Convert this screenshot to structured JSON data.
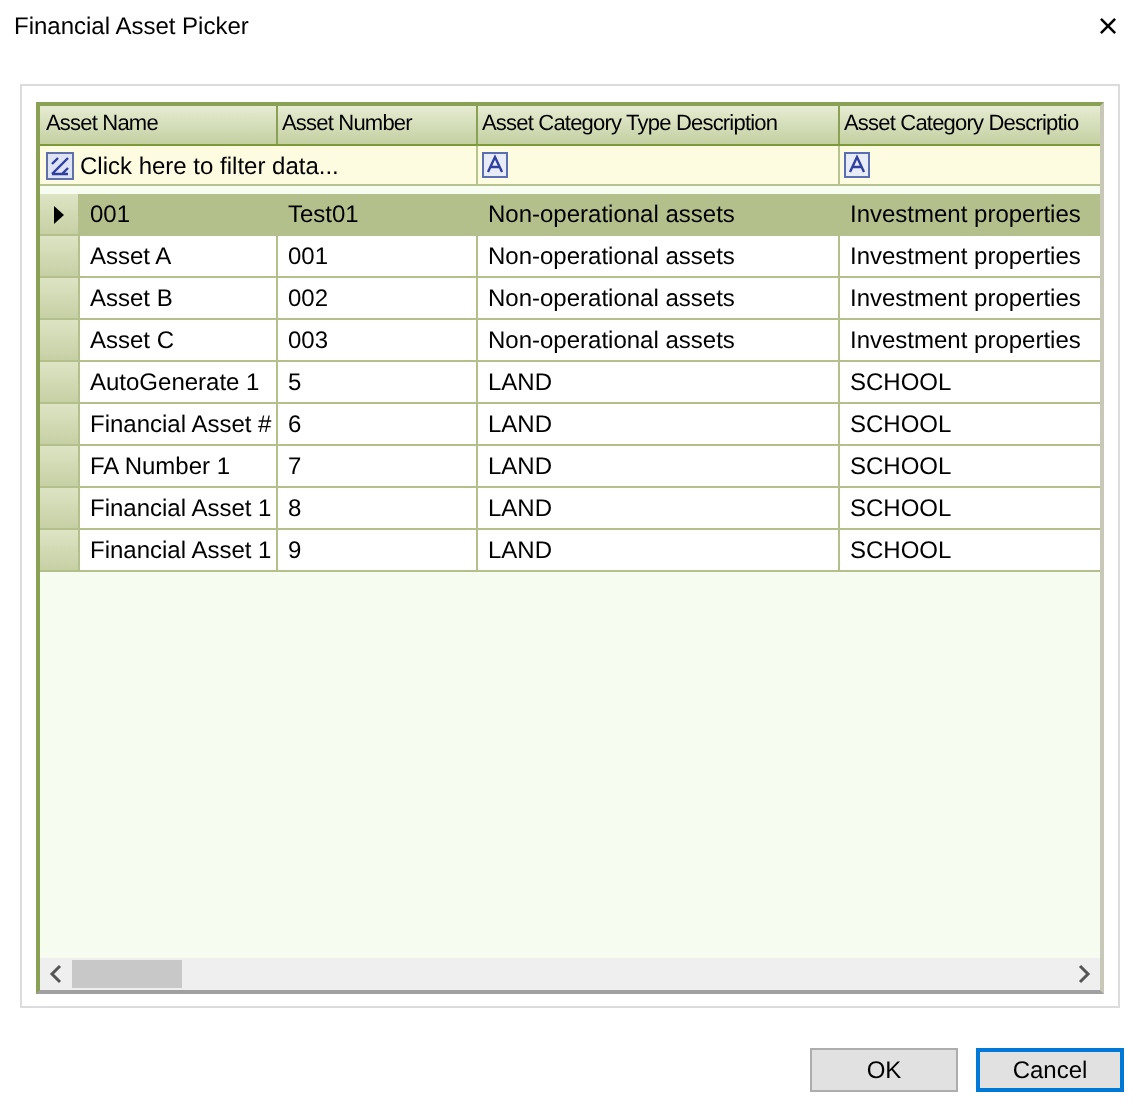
{
  "window": {
    "title": "Financial Asset Picker",
    "close": "×"
  },
  "table": {
    "columns": [
      "Asset Name",
      "Asset Number",
      "Asset Category Type Description",
      "Asset Category Descriptio"
    ],
    "filter_prompt": "Click here to filter data...",
    "rows": [
      {
        "cells": [
          "001",
          "Test01",
          "Non-operational assets",
          "Investment properties"
        ],
        "selected": true
      },
      {
        "cells": [
          "Asset A",
          "001",
          "Non-operational assets",
          "Investment properties"
        ],
        "selected": false
      },
      {
        "cells": [
          "Asset B",
          "002",
          "Non-operational assets",
          "Investment properties"
        ],
        "selected": false
      },
      {
        "cells": [
          "Asset C",
          "003",
          "Non-operational assets",
          "Investment properties"
        ],
        "selected": false
      },
      {
        "cells": [
          "AutoGenerate 1",
          "5",
          "LAND",
          "SCHOOL"
        ],
        "selected": false
      },
      {
        "cells": [
          "Financial Asset #",
          "6",
          "LAND",
          "SCHOOL"
        ],
        "selected": false
      },
      {
        "cells": [
          "FA Number 1",
          "7",
          "LAND",
          "SCHOOL"
        ],
        "selected": false
      },
      {
        "cells": [
          "Financial Asset 1",
          "8",
          "LAND",
          "SCHOOL"
        ],
        "selected": false
      },
      {
        "cells": [
          "Financial Asset 1",
          "9",
          "LAND",
          "SCHOOL"
        ],
        "selected": false
      }
    ]
  },
  "buttons": [
    {
      "label": "OK",
      "kind": "normal"
    },
    {
      "label": "Cancel",
      "kind": "default"
    }
  ]
}
